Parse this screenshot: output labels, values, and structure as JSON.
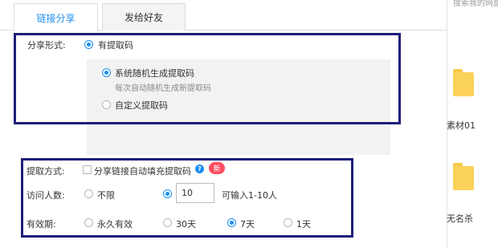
{
  "tabs": [
    {
      "label": "链接分享",
      "active": true
    },
    {
      "label": "发给好友",
      "active": false
    }
  ],
  "share_form": {
    "label": "分享形式:",
    "option_with_code": "有提取码",
    "system_random": "系统随机生成提取码",
    "system_random_hint": "每次自动随机生成新提取码",
    "custom_code": "自定义提取码"
  },
  "extract_method": {
    "label": "提取方式:",
    "checkbox_label": "分享链接自动填充提取码",
    "badge": "新"
  },
  "visitors": {
    "label": "访问人数:",
    "unlimited": "不限",
    "count_value": "10",
    "hint": "可输入1-10人"
  },
  "validity": {
    "label": "有效期:",
    "options": [
      "永久有效",
      "30天",
      "7天",
      "1天"
    ]
  },
  "background_window": {
    "top_text": "搜索我的网盘",
    "folders": [
      "素材01",
      "无名杀"
    ],
    "folder_color": "#fbd259"
  },
  "colors": {
    "accent": "#1a8ff2",
    "highlight_box": "#1e1e7a",
    "badge": "#ff4c61"
  }
}
